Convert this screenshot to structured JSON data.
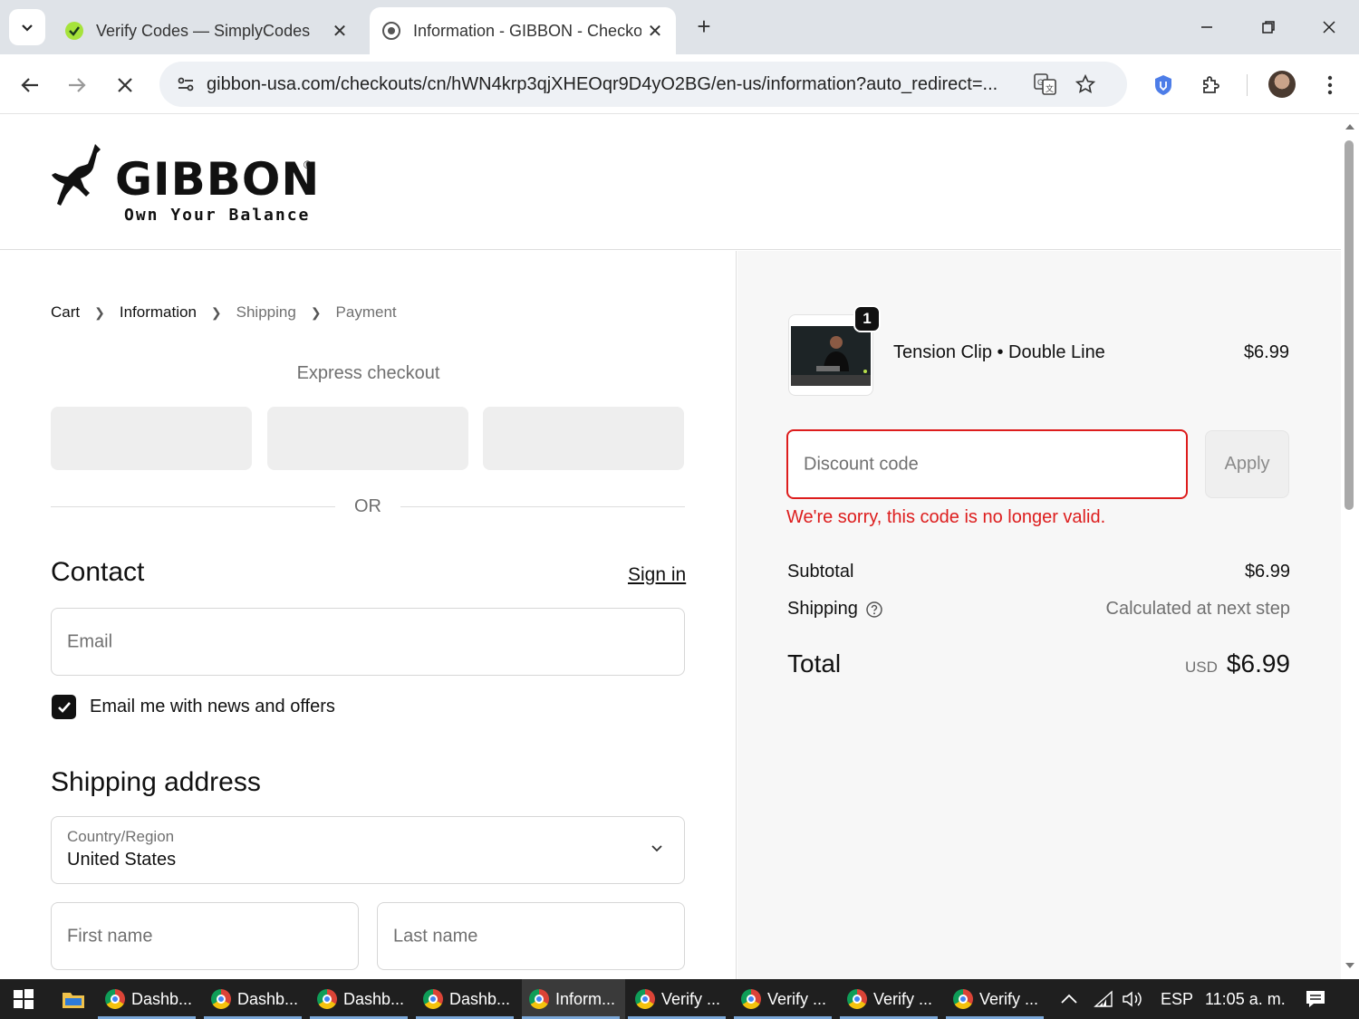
{
  "browser": {
    "tabs": [
      {
        "title": "Verify Codes — SimplyCodes",
        "active": false
      },
      {
        "title": "Information - GIBBON - Checkout",
        "active": true
      }
    ],
    "url": "gibbon-usa.com/checkouts/cn/hWN4krp3qjXHEOqr9D4yO2BG/en-us/information?auto_redirect=..."
  },
  "brand": {
    "name": "GIBBON",
    "registered": "®",
    "tagline": "Own Your Balance"
  },
  "breadcrumb": {
    "cart": "Cart",
    "information": "Information",
    "shipping": "Shipping",
    "payment": "Payment"
  },
  "express": {
    "title": "Express checkout",
    "or": "OR"
  },
  "contact": {
    "title": "Contact",
    "sign_in": "Sign in",
    "email_placeholder": "Email",
    "newsletter_label": "Email me with news and offers",
    "newsletter_checked": true
  },
  "shipping_address": {
    "title": "Shipping address",
    "country_label": "Country/Region",
    "country_value": "United States",
    "first_name_placeholder": "First name",
    "last_name_placeholder": "Last name"
  },
  "order": {
    "item": {
      "name": "Tension Clip • Double Line",
      "price": "$6.99",
      "quantity": "1"
    },
    "discount_placeholder": "Discount code",
    "apply_label": "Apply",
    "error_message": "We're sorry, this code is no longer valid.",
    "subtotal_label": "Subtotal",
    "subtotal_value": "$6.99",
    "shipping_label": "Shipping",
    "shipping_value": "Calculated at next step",
    "total_label": "Total",
    "total_currency": "USD",
    "total_value": "$6.99"
  },
  "taskbar": {
    "apps": [
      {
        "label": "Dashb...",
        "active": false
      },
      {
        "label": "Dashb...",
        "active": false
      },
      {
        "label": "Dashb...",
        "active": false
      },
      {
        "label": "Dashb...",
        "active": false
      },
      {
        "label": "Inform...",
        "active": true
      },
      {
        "label": "Verify ...",
        "active": false
      },
      {
        "label": "Verify ...",
        "active": false
      },
      {
        "label": "Verify ...",
        "active": false
      },
      {
        "label": "Verify ...",
        "active": false
      }
    ],
    "language": "ESP",
    "time": "11:05 a. m."
  },
  "colors": {
    "error": "#dd1d1d",
    "accent_dark": "#111111",
    "panel_bg": "#f7f7f7"
  }
}
